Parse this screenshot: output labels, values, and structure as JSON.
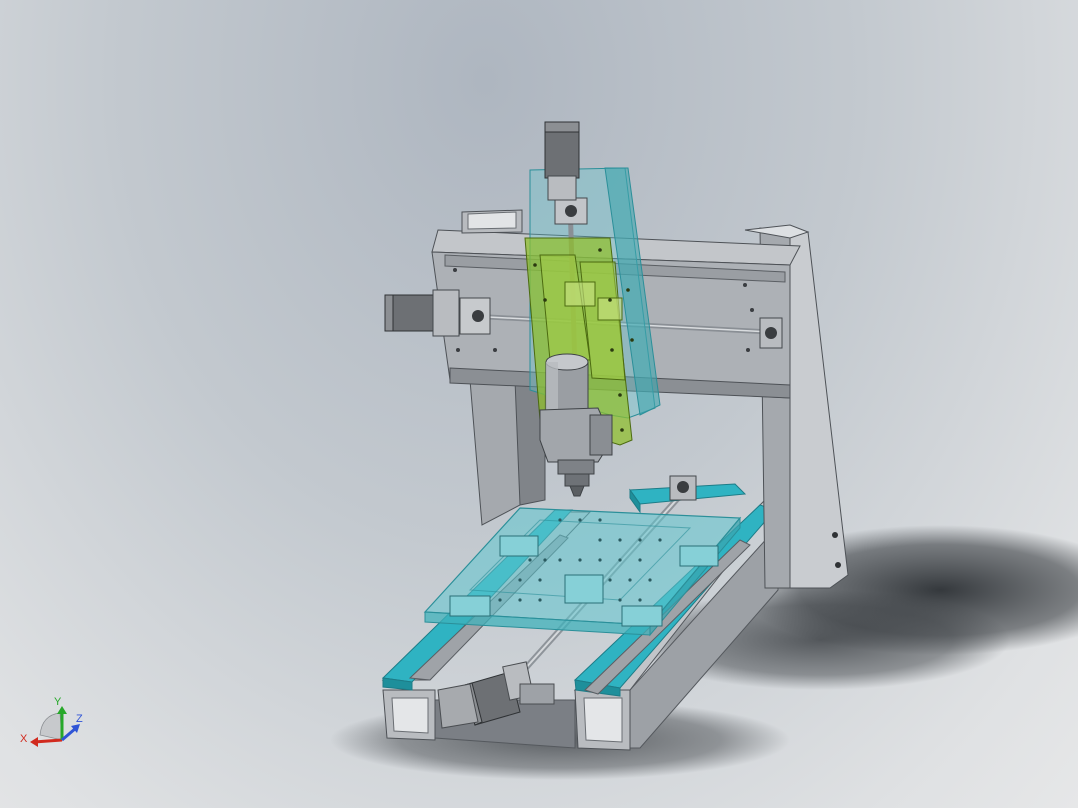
{
  "viewport": {
    "background_top": "#aeb6c0",
    "background_bottom": "#e6e7e8"
  },
  "model": {
    "kind": "cnc-gantry-router-assembly",
    "colors": {
      "frame_steel": "#b4b7bc",
      "frame_dark": "#8a8e94",
      "bed_glass_cyan": "#5ec6cf",
      "rail_cyan": "#2fb3c2",
      "z_carriage_green": "#8fbf2a",
      "spindle": "#9a9ea3",
      "motor": "#6d7074",
      "shadow": "#3a3e42"
    }
  },
  "triad": {
    "x_label": "X",
    "y_label": "Y",
    "z_label": "Z",
    "x_color": "#d12a1e",
    "y_color": "#27a82a",
    "z_color": "#2f54d6"
  }
}
